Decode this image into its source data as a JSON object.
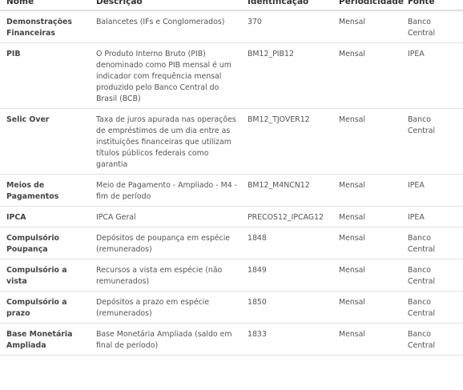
{
  "table": {
    "headers": [
      "Nome",
      "Descrição",
      "Identificação",
      "Periodicidade",
      "Fonte"
    ],
    "rows": [
      {
        "nome": "Demonstrações Financeiras",
        "descricao": "Balancetes (IFs e Conglomerados)",
        "identificacao": "370",
        "periodicidade": "Mensal",
        "fonte": "Banco Central"
      },
      {
        "nome": "PIB",
        "descricao": "O Produto Interno Bruto (PIB) denominado como PIB mensal é um indicador com frequência mensal produzido pelo Banco Central do Brasil (BCB)",
        "identificacao": "BM12_PIB12",
        "periodicidade": "Mensal",
        "fonte": "IPEA"
      },
      {
        "nome": "Selic Over",
        "descricao": "Taxa de juros apurada nas operações de empréstimos de um dia entre as instituições financeiras que utilizam títulos públicos federais como garantia",
        "identificacao": "BM12_TJOVER12",
        "periodicidade": "Mensal",
        "fonte": "Banco Central"
      },
      {
        "nome": "Meios de Pagamentos",
        "descricao": "Meio de Pagamento - Ampliado - M4 - fim de período",
        "identificacao": "BM12_M4NCN12",
        "periodicidade": "Mensal",
        "fonte": "IPEA"
      },
      {
        "nome": "IPCA",
        "descricao": "IPCA Geral",
        "identificacao": "PRECOS12_IPCAG12",
        "periodicidade": "Mensal",
        "fonte": "IPEA"
      },
      {
        "nome": "Compulsório Poupança",
        "descricao": "Depósitos de poupança em espécie (remunerados)",
        "identificacao": "1848",
        "periodicidade": "Mensal",
        "fonte": "Banco Central"
      },
      {
        "nome": "Compulsório a vista",
        "descricao": "Recursos a vista em espécie (não remunerados)",
        "identificacao": "1849",
        "periodicidade": "Mensal",
        "fonte": "Banco Central"
      },
      {
        "nome": "Compulsório a prazo",
        "descricao": "Depósitos a prazo em espécie (remunerados)",
        "identificacao": "1850",
        "periodicidade": "Mensal",
        "fonte": "Banco Central"
      },
      {
        "nome": "Base Monetária Ampliada",
        "descricao": "Base Monetária Ampliada (saldo em final de período)",
        "identificacao": "1833",
        "periodicidade": "Mensal",
        "fonte": "Banco Central"
      }
    ]
  }
}
